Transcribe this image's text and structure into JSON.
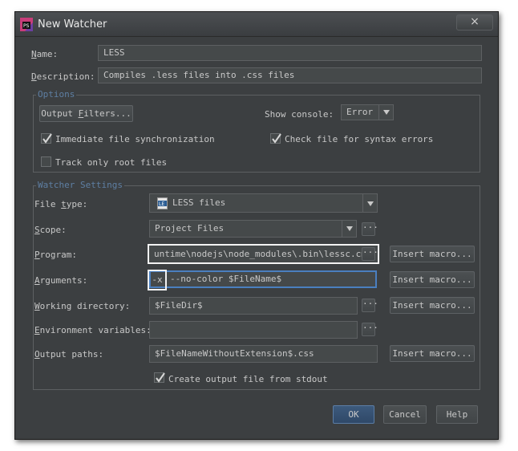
{
  "window": {
    "title": "New Watcher",
    "close_glyph": "×"
  },
  "name": {
    "label": "Name:",
    "value": "LESS"
  },
  "description": {
    "label": "Description:",
    "value": "Compiles .less files into .css files"
  },
  "options": {
    "legend": "Options",
    "output_filters_button": "Output Filters...",
    "show_console_label": "Show console:",
    "show_console_value": "Error",
    "immediate_sync_label": "Immediate file synchronization",
    "immediate_sync_checked": true,
    "check_syntax_label": "Check file for syntax errors",
    "check_syntax_checked": true,
    "track_root_label": "Track only root files",
    "track_root_checked": false
  },
  "watcher": {
    "legend": "Watcher Settings",
    "file_type_label": "File type:",
    "file_type_value": "LESS files",
    "file_type_icon": "less-file-icon",
    "scope_label": "Scope:",
    "scope_value": "Project Files",
    "program_label": "Program:",
    "program_value": "untime\\nodejs\\node_modules\\.bin\\lessc.cmd",
    "arguments_label": "Arguments:",
    "arguments_value": "--no-color $FileName$",
    "arguments_highlight": "-x",
    "working_dir_label": "Working directory:",
    "working_dir_value": "$FileDir$",
    "env_vars_label": "Environment variables:",
    "env_vars_value": "",
    "output_paths_label": "Output paths:",
    "output_paths_value": "$FileNameWithoutExtension$.css",
    "create_output_label": "Create output file from stdout",
    "create_output_checked": true,
    "insert_macro_label": "Insert macro...",
    "browse_glyph": "···"
  },
  "footer": {
    "ok": "OK",
    "cancel": "Cancel",
    "help": "Help"
  },
  "colors": {
    "background": "#3c3f41",
    "field": "#45494a",
    "accent": "#4a7fbf",
    "legend": "#5e7fa3"
  }
}
